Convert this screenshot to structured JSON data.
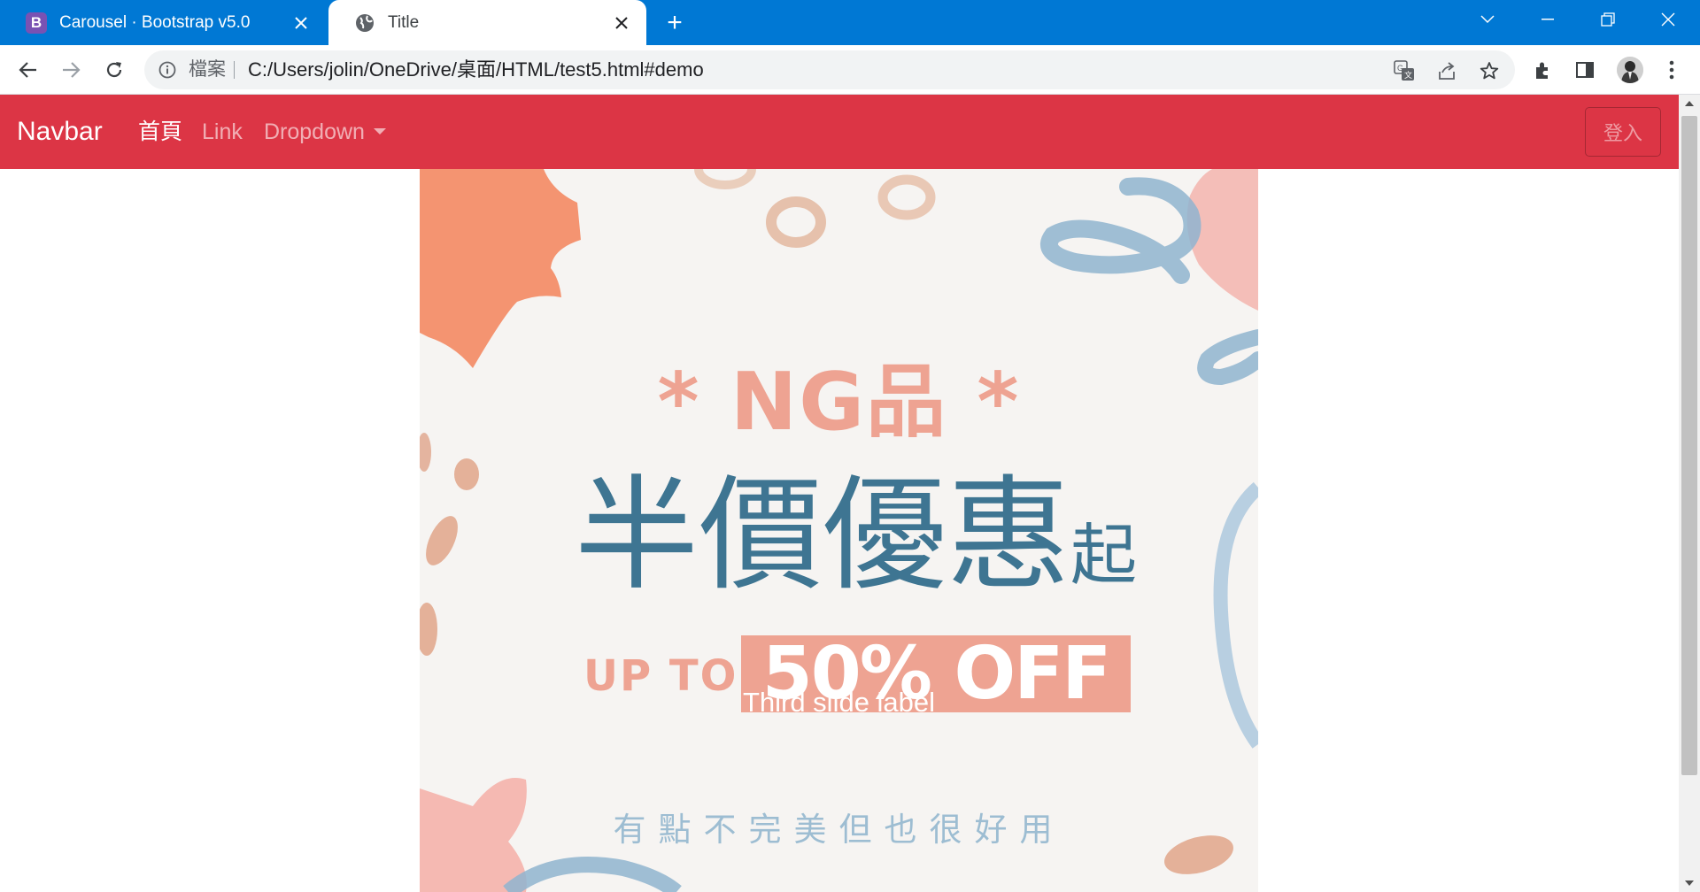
{
  "browser": {
    "tabs": [
      {
        "title": "Carousel · Bootstrap v5.0",
        "favicon": "B",
        "active": false
      },
      {
        "title": "Title",
        "active": true
      }
    ],
    "address_bar": {
      "scheme_label": "檔案",
      "url": "C:/Users/jolin/OneDrive/桌面/HTML/test5.html#demo"
    },
    "colors": {
      "titlebar": "#0078d4"
    },
    "icons": [
      "back-arrow-icon",
      "forward-arrow-icon",
      "reload-icon",
      "info-icon",
      "translate-icon",
      "share-icon",
      "star-icon",
      "extensions-icon",
      "side-panel-icon",
      "profile-avatar",
      "more-menu-icon"
    ]
  },
  "page": {
    "navbar": {
      "brand": "Navbar",
      "links": [
        {
          "label": "首頁",
          "active": true
        },
        {
          "label": "Link",
          "active": false
        },
        {
          "label": "Dropdown",
          "active": false
        }
      ],
      "login_button": "登入",
      "color": "#dc3545"
    },
    "carousel": {
      "slide_image_text": {
        "headline": "* NG品 *",
        "title": "半價優惠",
        "title_suffix": "起",
        "up_to": "UP TO",
        "off": "50% OFF",
        "tagline": "有點不完美但也很好用"
      },
      "caption": "Third slide label"
    }
  }
}
